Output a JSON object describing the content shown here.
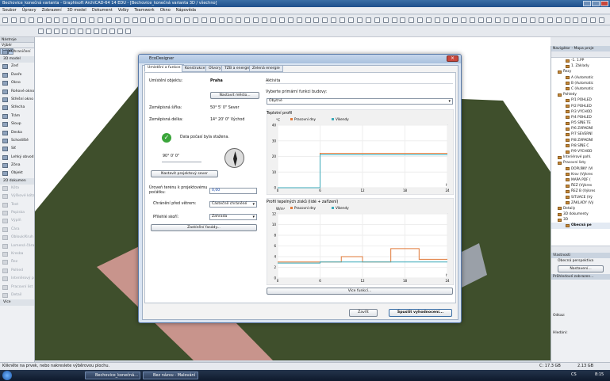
{
  "window": {
    "title": "Bechovice_konečná varianta - Graphisoft ArchiCAD-64 14 EDU - [Bechovice_konečná varianta 3D / všechno]"
  },
  "menu": [
    "Soubor",
    "Úpravy",
    "Zobrazení",
    "3D model",
    "Dokument",
    "Volby",
    "Teamwork",
    "Okno",
    "Nápověda"
  ],
  "left_toolbox": {
    "header": "Nástroje",
    "subheader": "Výběr",
    "items": [
      {
        "label": "Šipka",
        "state": "sel"
      },
      {
        "label": "Ohraničení",
        "state": "on"
      }
    ],
    "section_3d": "3D model",
    "items_3d": [
      "Zeď",
      "Dveře",
      "Okno",
      "Rohové okno",
      "Střešní okno",
      "Střecha",
      "Trám",
      "Sloup",
      "Deska",
      "Schodiště",
      "Síť",
      "Lehký obvod. plášť",
      "Zóna",
      "Objekt"
    ],
    "section_2d": "2D dokumen",
    "items_2d": [
      "Kóta",
      "Výškové kóta",
      "Text",
      "Popiska",
      "Výplň",
      "Čára",
      "Oblouk/Kruh",
      "Lomená čára",
      "Kresba",
      "Řez",
      "Pohled",
      "Interiérový pohled",
      "Pracovní list",
      "Detail"
    ],
    "more": "Více"
  },
  "dialog": {
    "title": "EcoDesigner",
    "tabs": [
      "Umístění a funkce",
      "Konstrukce",
      "Otvory",
      "TZB a energie",
      "Zelená energie"
    ],
    "location_label": "Umístění objektu:",
    "location_value": "Praha",
    "set_city_btn": "Nastavit město...",
    "lat_label": "Zeměpisná šířka:",
    "lat_value": "50° 5' 0\" Sever",
    "lon_label": "Zeměpisná délka:",
    "lon_value": "14° 20' 0\" Východ",
    "weather_msg": "Data počasí byla stažena.",
    "north_value": "90° 0' 0\"",
    "set_north_btn": "Nastavit projektový sever",
    "terrain_label": "Úroveň terénu k projektovému počátku:",
    "terrain_value": "0,00",
    "wind_label": "Chránění před větrem:",
    "wind_value": "Částečně chráněné",
    "soil_label": "Přilehlé skoří:",
    "soil_value": "Zahrada",
    "shading_btn": "Zastínění fasády...",
    "activity_title": "Aktivita",
    "function_label": "Vyberte primární funkci budovy:",
    "function_value": "Obytné",
    "more_btn": "Více funkcí...",
    "cancel_btn": "Zavřít",
    "run_btn": "Spustit vyhodnocení..."
  },
  "chart_data": [
    {
      "type": "line",
      "title": "Teplotní profil",
      "ylabel": "°C",
      "xlabel": "h",
      "ylim": [
        0,
        40
      ],
      "yticks": [
        0,
        10,
        20,
        30,
        40
      ],
      "xlim": [
        0,
        24
      ],
      "xticks": [
        0,
        6,
        12,
        18,
        24
      ],
      "series": [
        {
          "name": "Pracovní dny",
          "color": "#e07a3a",
          "x": [
            0,
            6,
            6,
            12,
            12,
            18,
            18,
            24
          ],
          "y": [
            0,
            0,
            22,
            22,
            22,
            22,
            22,
            22
          ]
        },
        {
          "name": "Víkendy",
          "color": "#39a9b8",
          "x": [
            0,
            6,
            6,
            12,
            12,
            18,
            18,
            24
          ],
          "y": [
            0,
            0,
            21,
            21,
            21,
            21,
            21,
            21
          ]
        }
      ]
    },
    {
      "type": "line",
      "title": "Profil tepelných zisků (lidé + zařízení)",
      "ylabel": "W/m²",
      "xlabel": "h",
      "ylim": [
        0,
        12
      ],
      "yticks": [
        0,
        2,
        4,
        6,
        8,
        10,
        12
      ],
      "xlim": [
        0,
        24
      ],
      "xticks": [
        0,
        6,
        12,
        18,
        24
      ],
      "series": [
        {
          "name": "Pracovní dny",
          "color": "#e07a3a",
          "x": [
            0,
            6,
            6,
            9,
            9,
            12,
            12,
            16,
            16,
            20,
            20,
            24
          ],
          "y": [
            3,
            3,
            3,
            3,
            4,
            4,
            3,
            3,
            5.5,
            5.5,
            3.5,
            3.5
          ]
        },
        {
          "name": "Víkendy",
          "color": "#39a9b8",
          "x": [
            0,
            6,
            6,
            12,
            12,
            18,
            18,
            24
          ],
          "y": [
            2.8,
            2.8,
            3,
            3,
            3,
            3,
            3,
            3
          ]
        }
      ]
    }
  ],
  "navigator": {
    "header": "Navigátor - Mapa proje",
    "items": [
      "-1. 1.PP",
      "1. Základy",
      "Řezy",
      "A (Automatic",
      "B (Automatic",
      "C (Automatic",
      "Pohledy",
      "P/1 POHLED",
      "P/2 POHLED",
      "P/3 VÝCHOD",
      "P/4 POHLED",
      "P/5 SÍŇE TE",
      "P/6 ZÁPADNÍ",
      "P/7 SEVERNÍ",
      "P/8 ZÁPADNÍ",
      "P/8 SÍŇE C",
      "P/9 VÝCHOD",
      "Interiérové pohl.",
      "Pracovní listy",
      "DOPLŇKY (Vl",
      "Krov (Výkres",
      "MAPA PDF (",
      "ŘEZ (Výkres",
      "ŘEZ B (Výkres",
      "SITUACE (Vý",
      "ZÁKLADY (Vý",
      "Detaily",
      "3D dokumenty",
      "3D",
      "Obecná pe"
    ],
    "view_header": "Vlastnosti",
    "view_value": "Obecná perspektiva",
    "settings_btn": "Nastavení...",
    "nav_header": "Průhledové zobrazen...",
    "label_a": "Odkaz:",
    "label_b": "Hledání:"
  },
  "status": {
    "hint": "Klikněte na prvek, nebo nakreslete výběrovou plochu.",
    "disk": "C: 17.3 GB",
    "ram": "2.13 GB"
  },
  "taskbar": {
    "tasks": [
      "Bechovice_konečná...",
      "Bez názvu - Malování"
    ],
    "lang": "CS",
    "time": "8:15"
  },
  "colors": {
    "sky": "#ffffff",
    "grass": "#3e4f2b",
    "path": "#c9958d",
    "accent": "#3a6ea5"
  }
}
